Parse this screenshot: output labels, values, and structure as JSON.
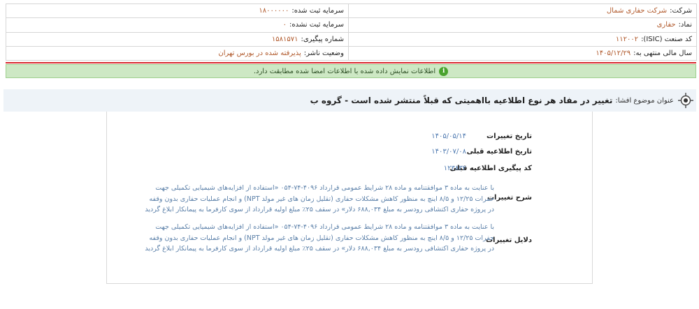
{
  "company": {
    "rows": [
      {
        "l_label": "شرکت:",
        "l_value": "شرکت حفاری شمال",
        "r_label": "سرمایه ثبت شده:",
        "r_value": "۱۸۰۰۰۰۰۰"
      },
      {
        "l_label": "نماد:",
        "l_value": "حفاری",
        "r_label": "سرمایه ثبت نشده:",
        "r_value": "۰"
      },
      {
        "l_label": "کد صنعت (ISIC):",
        "l_value": "۱۱۲۰۰۲",
        "r_label": "شماره پیگیری:",
        "r_value": "۱۵۸۱۵۷۱"
      },
      {
        "l_label": "سال مالی منتهی به:",
        "l_value": "۱۴۰۵/۱۲/۲۹",
        "r_label": "وضعیت ناشر:",
        "r_value": "پذیرفته شده در بورس تهران"
      }
    ]
  },
  "notice": {
    "text": "اطلاعات نمایش داده شده با اطلاعات امضا شده مطابقت دارد.",
    "icon": "info-icon"
  },
  "topic": {
    "label": "عنوان موضوع افشا:",
    "title": "تغییر در مفاد هر نوع اطلاعیه بااهمیتی که قبلاً منتشر شده است - گروه ب"
  },
  "fields": {
    "change_date": {
      "label": "تاریخ تغییرات",
      "value": "۱۴۰۵/۰۵/۱۴"
    },
    "prev_date": {
      "label": "تاریخ اطلاعیه قبلی",
      "value": "۱۴۰۳/۰۷/۰۸"
    },
    "prev_code": {
      "label": "کد پیگیری اطلاعیه قبلی",
      "value": "۱۲۳۸۳۲"
    },
    "description": {
      "label": "شرح تغییرات",
      "lines": [
        "با عنایت به ماده ۳ موافقتنامه و ماده ۲۸ شرایط عمومی قرارداد ۴۰۹۶-۷۴-۰۵۴ «استفاده از افزایه‌های شیمیایی تکمیلی جهت",
        "حفرات ۱۲/۲۵ و ۸/۵ اینچ به منظور کاهش مشکلات حفاری (تقلیل زمان های غیر مولد NPT) و انجام عملیات حفاری بدون وقفه",
        "در پروژه حفاری اکتشافی رودسر به مبلغ ۶۸۸,۰۳۴ دلار» در سقف ۲۵٪ مبلغ اولیه قرارداد از سوی کارفرما به پیمانکار ابلاغ گردید."
      ]
    },
    "reasons": {
      "label": "دلایل تغییرات",
      "lines": [
        "با عنایت به ماده ۳ موافقتنامه و ماده ۲۸ شرایط عمومی قرارداد ۴۰۹۶-۷۴-۰۵۴ «استفاده از افزایه‌های شیمیایی تکمیلی جهت",
        "حفرات ۱۲/۲۵ و ۸/۵ اینچ به منظور کاهش مشکلات حفاری (تقلیل زمان های غیر مولد NPT) و انجام عملیات حفاری بدون وقفه",
        "در پروژه حفاری اکتشافی رودسر به مبلغ ۶۸۸,۰۳۴ دلار» در سقف ۲۵٪ مبلغ اولیه قرارداد از سوی کارفرما به پیمانکار ابلاغ گردید."
      ]
    }
  },
  "colors": {
    "accent_value": "#b0582a",
    "link_blue": "#4e79b0",
    "alert_red": "#d7262b",
    "notice_bg": "#cde8c4"
  }
}
